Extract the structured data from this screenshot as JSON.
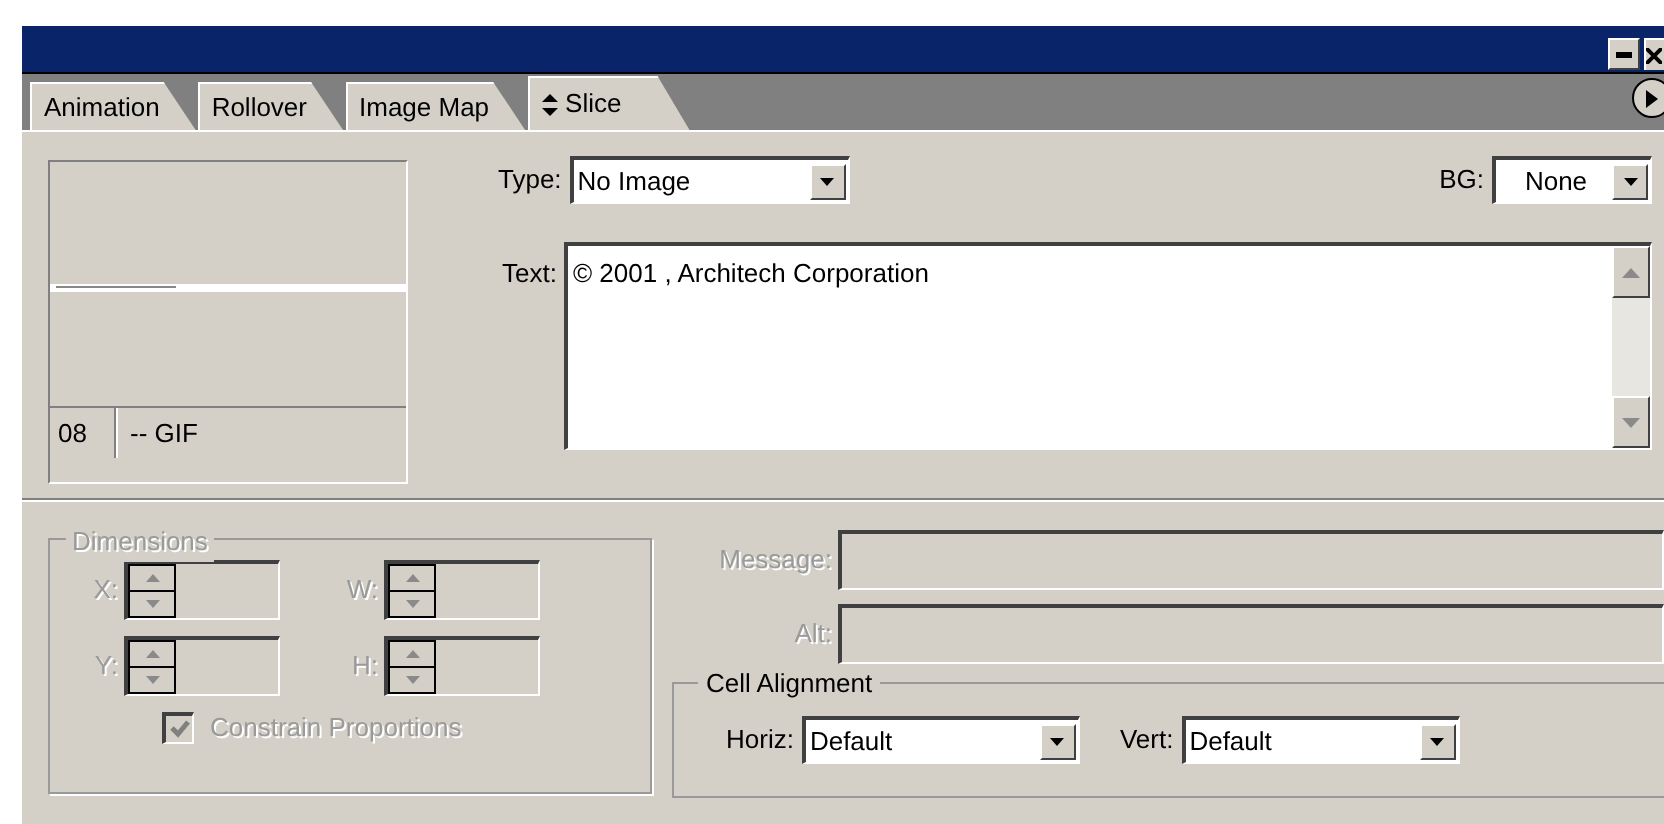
{
  "tabs": [
    {
      "label": "Animation",
      "selected": false
    },
    {
      "label": "Rollover",
      "selected": false
    },
    {
      "label": "Image Map",
      "selected": false
    },
    {
      "label": "Slice",
      "selected": true
    }
  ],
  "preview": {
    "frame": "08",
    "format": "-- GIF"
  },
  "type": {
    "label": "Type:",
    "value": "No Image"
  },
  "bg": {
    "label": "BG:",
    "value": "None"
  },
  "text": {
    "label": "Text:",
    "value": "© 2001 , Architech Corporation"
  },
  "dimensions": {
    "title": "Dimensions",
    "disabled": true,
    "fields": [
      {
        "label": "X:"
      },
      {
        "label": "W:"
      },
      {
        "label": "Y:"
      },
      {
        "label": "H:"
      }
    ],
    "constrain": {
      "label": "Constrain Proportions",
      "checked": true
    }
  },
  "message": {
    "label": "Message:",
    "disabled": true
  },
  "alt": {
    "label": "Alt:",
    "disabled": true
  },
  "cell_alignment": {
    "title": "Cell Alignment",
    "horiz": {
      "label": "Horiz:",
      "value": "Default"
    },
    "vert": {
      "label": "Vert:",
      "value": "Default"
    }
  }
}
